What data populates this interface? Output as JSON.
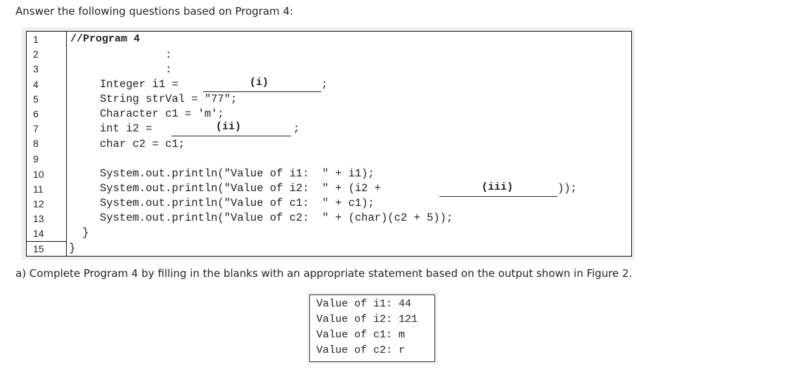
{
  "intro": "Answer the following questions based on Program 4:",
  "line_numbers": [
    "1",
    "2",
    "3",
    "4",
    "5",
    "6",
    "7",
    "8",
    "9",
    "10",
    "11",
    "12",
    "13",
    "14",
    "15"
  ],
  "code": {
    "l1": "//Program 4",
    "l2": ":",
    "l3": ":",
    "l4_a": "Integer i1 =",
    "l4_blank": "(i)",
    "l4_b": ";",
    "l5": "String strVal = \"77\";",
    "l6": "Character c1 = 'm';",
    "l7_a": "int i2 =",
    "l7_blank": "(ii)",
    "l7_b": ";",
    "l8": "char c2 = c1;",
    "l10": "System.out.println(\"Value of i1:  \" + i1);",
    "l11_a": "System.out.println(\"Value of i2:  \" + (i2 +",
    "l11_blank": "(iii)",
    "l11_b": "));",
    "l12": "System.out.println(\"Value of c1:  \" + c1);",
    "l13": "System.out.println(\"Value of c2:  \" + (char)(c2 + 5));",
    "l14": "}",
    "l15": "}"
  },
  "question_a": "a) Complete Program 4 by filling in the blanks with an appropriate statement based on the output shown in Figure 2.",
  "output": [
    "Value of i1: 44",
    "Value of i2: 121",
    "Value of c1: m",
    "Value of c2: r"
  ]
}
